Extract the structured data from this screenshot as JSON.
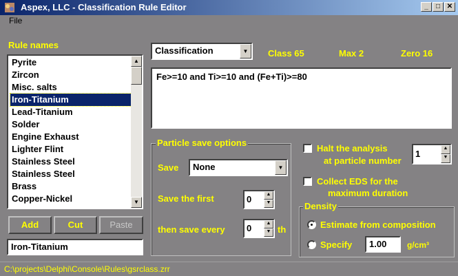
{
  "window": {
    "title": "Aspex, LLC - Classification Rule Editor",
    "icons": {
      "app": "app-icon",
      "minimize": "minimize-icon",
      "maximize": "maximize-icon",
      "close": "close-icon"
    },
    "minimize_glyph": "_",
    "maximize_glyph": "□",
    "close_glyph": "✕"
  },
  "menu": {
    "file": "File"
  },
  "rules": {
    "header": "Rule names",
    "items": [
      "Pyrite",
      "Zircon",
      "Misc. salts",
      "Iron-Titanium",
      "Lead-Titanium",
      "Solder",
      "Engine Exhaust",
      "Lighter Flint",
      "Stainless Steel",
      "Stainless Steel",
      "Brass",
      "Copper-Nickel"
    ],
    "selected": "Iron-Titanium",
    "add_label": "Add",
    "cut_label": "Cut",
    "paste_label": "Paste",
    "name_value": "Iron-Titanium"
  },
  "classification": {
    "selected": "Classification",
    "class_label": "Class 65",
    "max_label": "Max 2",
    "zero_label": "Zero 16",
    "rule_text": "Fe>=10 and Ti>=10 and (Fe+Ti)>=80"
  },
  "particle_save": {
    "legend": "Particle save options",
    "save_label": "Save",
    "save_value": "None",
    "save_first_label": "Save the first",
    "save_first_value": "0",
    "then_every_label": "then save every",
    "then_every_value": "0",
    "th_label": "th"
  },
  "halt": {
    "label_line1": "Halt the analysis",
    "label_line2": "at particle number",
    "value": "1",
    "checked": false
  },
  "collect_eds": {
    "label_line1": "Collect EDS for the",
    "label_line2": "maximum duration",
    "checked": false
  },
  "density": {
    "legend": "Density",
    "estimate_label": "Estimate from composition",
    "specify_label": "Specify",
    "specify_value": "1.00",
    "unit": "g/cm³",
    "selected": "estimate"
  },
  "status": {
    "path": "C:\\projects\\Delphi\\Console\\Rules\\gsrclass.zrr"
  },
  "colors": {
    "background": "#848284",
    "label": "#ffff00",
    "title_start": "#0a246a",
    "selection": "#0a246a"
  }
}
